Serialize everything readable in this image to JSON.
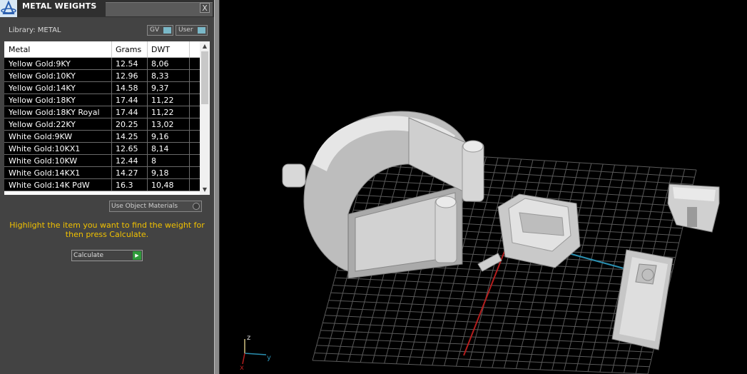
{
  "panel": {
    "title": "METAL WEIGHTS",
    "library_label": "Library: METAL",
    "toggle_gv": "GV",
    "toggle_user": "User",
    "close_glyph": "X",
    "use_object_materials": "Use Object Materials",
    "hint": "Highlight the item you want to find the weight for then press Calculate.",
    "calculate_label": "Calculate"
  },
  "table": {
    "columns": [
      "Metal",
      "Grams",
      "DWT"
    ],
    "rows": [
      [
        "Yellow Gold:9KY",
        "12.54",
        "8,06"
      ],
      [
        "Yellow Gold:10KY",
        "12.96",
        "8,33"
      ],
      [
        "Yellow Gold:14KY",
        "14.58",
        "9,37"
      ],
      [
        "Yellow Gold:18KY",
        "17.44",
        "11,22"
      ],
      [
        "Yellow Gold:18KY Royal",
        "17.44",
        "11,22"
      ],
      [
        "Yellow Gold:22KY",
        "20.25",
        "13,02"
      ],
      [
        "White Gold:9KW",
        "14.25",
        "9,16"
      ],
      [
        "White Gold:10KX1",
        "12.65",
        "8,14"
      ],
      [
        "White Gold:10KW",
        "12.44",
        "8"
      ],
      [
        "White Gold:14KX1",
        "14.27",
        "9,18"
      ],
      [
        "White Gold:14K PdW",
        "16.3",
        "10,48"
      ]
    ]
  },
  "viewport": {
    "axis_x": "x",
    "axis_y": "y",
    "axis_z": "z",
    "colors": {
      "grid": "#5a5a5a",
      "x_axis": "#b41e1e",
      "y_axis": "#2a8fb0",
      "model": "#cfcfcf"
    }
  }
}
